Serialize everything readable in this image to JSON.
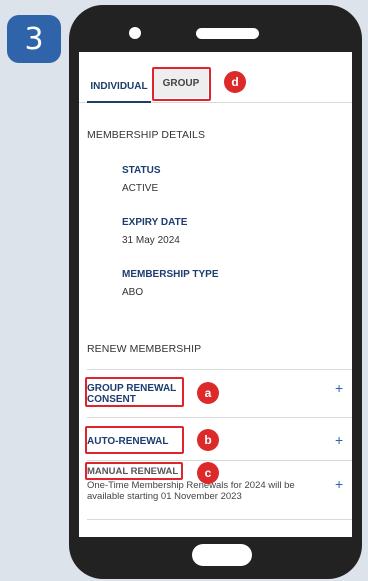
{
  "step_number": "3",
  "tabs": {
    "individual": "INDIVIDUAL",
    "group": "GROUP"
  },
  "membership_details": {
    "heading": "MEMBERSHIP DETAILS",
    "status_label": "STATUS",
    "status_value": "ACTIVE",
    "expiry_label": "EXPIRY DATE",
    "expiry_value": "31 May 2024",
    "type_label": "MEMBERSHIP TYPE",
    "type_value": "ABO"
  },
  "renew": {
    "heading": "RENEW MEMBERSHIP",
    "group_renewal_line1": "GROUP RENEWAL",
    "group_renewal_line2": "CONSENT",
    "auto_renewal": "AUTO-RENEWAL",
    "manual_renewal": "MANUAL RENEWAL",
    "manual_note": "One-Time Membership Renewals for 2024 will be available starting 01 November 2023",
    "expand_symbol": "+"
  },
  "callouts": {
    "a": "a",
    "b": "b",
    "c": "c",
    "d": "d"
  },
  "colors": {
    "accent": "#1c3d6e",
    "highlight": "#e0242d",
    "step_badge": "#2f63aa"
  }
}
